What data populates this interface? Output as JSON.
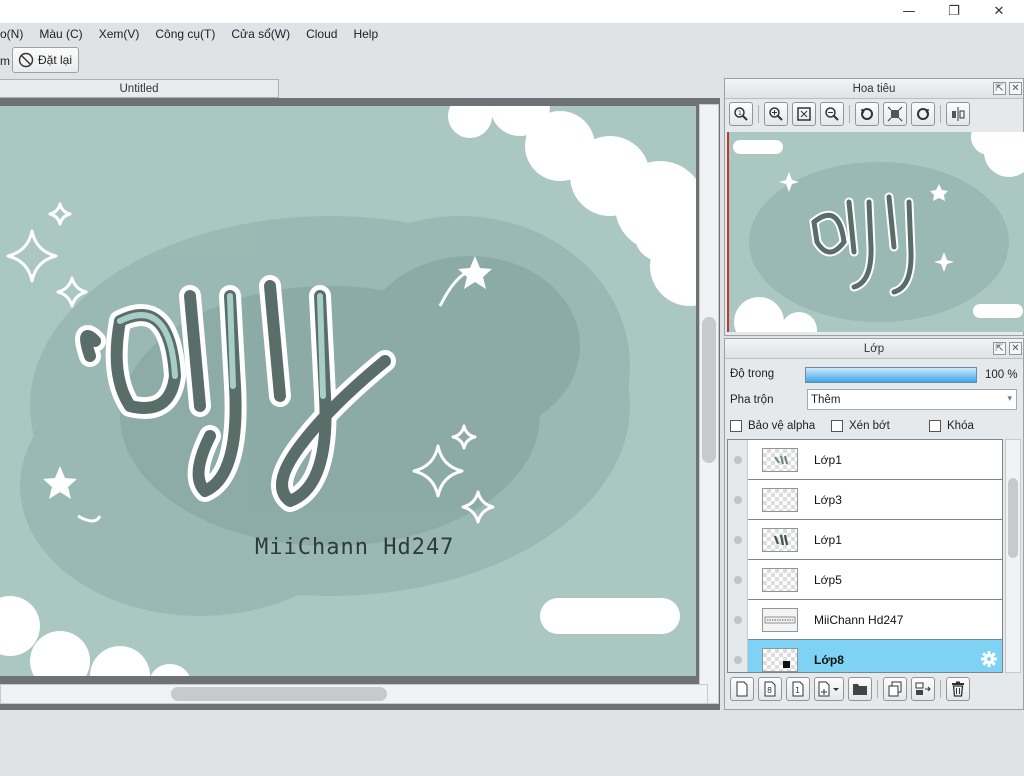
{
  "window": {
    "controls": {
      "minimize": "—",
      "restore": "❐",
      "close": "✕"
    }
  },
  "menu": {
    "items": [
      "o(N)",
      "Màu (C)",
      "Xem(V)",
      "Công cụ(T)",
      "Cửa sổ(W)",
      "Cloud",
      "Help"
    ]
  },
  "toolbar": {
    "left_fragment": "m",
    "reset_label": "Đặt lại"
  },
  "document": {
    "tab_title": "Untitled",
    "artwork_signature": "MiiChann Hd247"
  },
  "navigator": {
    "title": "Hoa tiêu",
    "tools": [
      "zoom-actual-icon",
      "zoom-in-icon",
      "fit-window-icon",
      "zoom-out-icon",
      "rotate-left-icon",
      "reset-view-icon",
      "rotate-right-icon",
      "flip-icon"
    ]
  },
  "layers_panel": {
    "title": "Lớp",
    "opacity_label": "Độ trong",
    "opacity_value": "100 %",
    "opacity": 1.0,
    "blend_label": "Pha trộn",
    "blend_value": "Thêm",
    "checkboxes": [
      {
        "label": "Bảo vệ alpha",
        "checked": false
      },
      {
        "label": "Xén bớt",
        "checked": false
      },
      {
        "label": "Khóa",
        "checked": false
      }
    ],
    "layers": [
      {
        "name": "Lớp1",
        "selected": false
      },
      {
        "name": "Lớp3",
        "selected": false
      },
      {
        "name": "Lớp1",
        "selected": false
      },
      {
        "name": "Lớp5",
        "selected": false
      },
      {
        "name": "MiiChann Hd247",
        "selected": false
      },
      {
        "name": "Lớp8",
        "selected": true
      }
    ],
    "bottom_tools": [
      "new-layer-icon",
      "new-8bit-layer-icon",
      "new-1bit-layer-icon",
      "add-layer-menu-icon",
      "folder-icon",
      "duplicate-icon",
      "merge-down-icon",
      "delete-icon"
    ]
  },
  "colors": {
    "canvas_bg": "#a9c6c1",
    "ink_dark": "#5f7470",
    "selected_layer": "#7ed3f4",
    "accent_blue": "#3ea7ea"
  }
}
